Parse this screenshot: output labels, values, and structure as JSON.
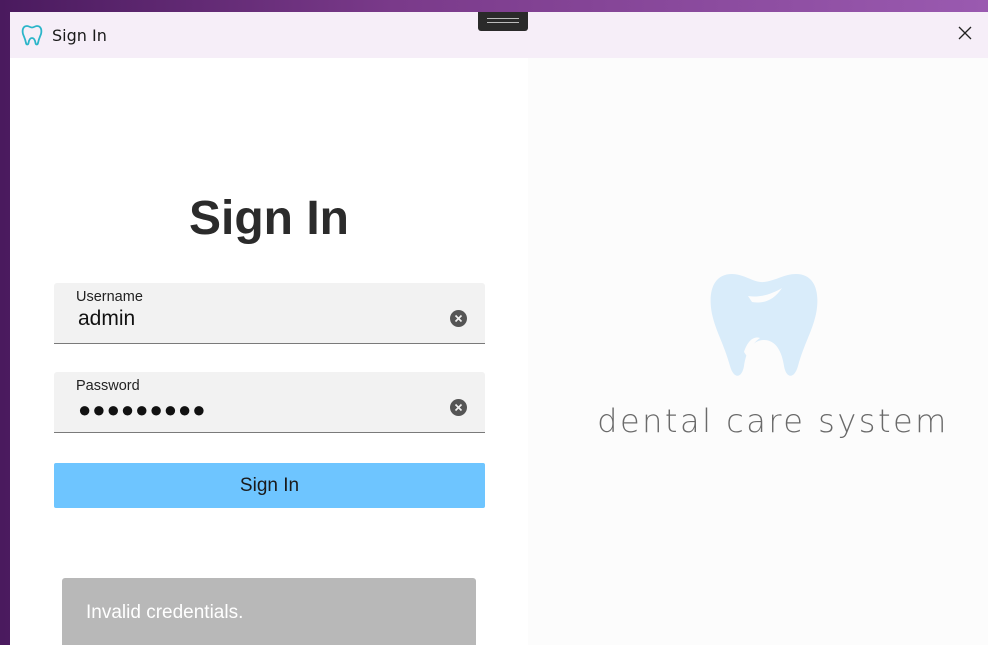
{
  "window": {
    "title": "Sign In",
    "app_icon": "tooth-icon",
    "close_icon": "close-icon"
  },
  "form": {
    "heading": "Sign In",
    "username": {
      "label": "Username",
      "value": "admin"
    },
    "password": {
      "label": "Password",
      "value": "●●●●●●●●●"
    },
    "clear_icon": "clear-icon",
    "submit_label": "Sign In"
  },
  "toast": {
    "message": "Invalid credentials."
  },
  "brand": {
    "logo_icon": "tooth-logo-icon",
    "name": "dental care system"
  },
  "colors": {
    "accent": "#6ec5ff",
    "logo": "#d9ecfa",
    "toast_bg": "#b8b8b8"
  }
}
